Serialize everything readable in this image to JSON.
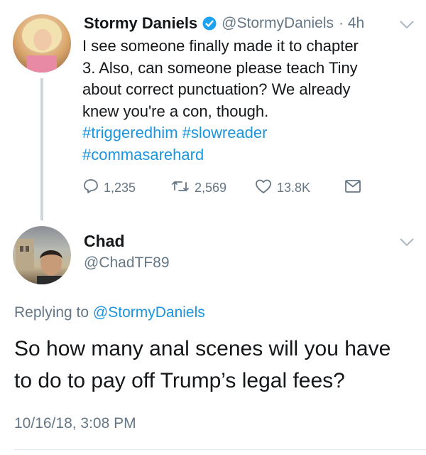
{
  "tweet": {
    "display_name": "Stormy Daniels",
    "handle": "@StormyDaniels",
    "time": "· 4h",
    "text_lines": [
      "I see someone finally made it to chapter",
      "3. Also, can someone please teach Tiny",
      "about correct punctuation? We already",
      "knew you're a con, though."
    ],
    "hashtag_line1": "#triggeredhim #slowreader",
    "hashtag_line2": "#commasarehard",
    "actions": {
      "replies": "1,235",
      "retweets": "2,569",
      "likes": "13.8K"
    }
  },
  "reply": {
    "display_name": "Chad",
    "handle": "@ChadTF89",
    "replying_prefix": "Replying to",
    "replying_to": "@StormyDaniels",
    "text_line1": "So how many anal scenes will you have",
    "text_line2": "to do to pay off Trump’s legal fees?",
    "timestamp": "10/16/18, 3:08 PM"
  },
  "icons": {
    "verified": "verified-badge-icon",
    "reply": "reply-icon",
    "retweet": "retweet-icon",
    "like": "heart-icon",
    "dm": "envelope-icon",
    "menu": "chevron-down-icon"
  },
  "colors": {
    "link": "#1b95e0",
    "muted": "#657786",
    "verified": "#1da1f2"
  }
}
